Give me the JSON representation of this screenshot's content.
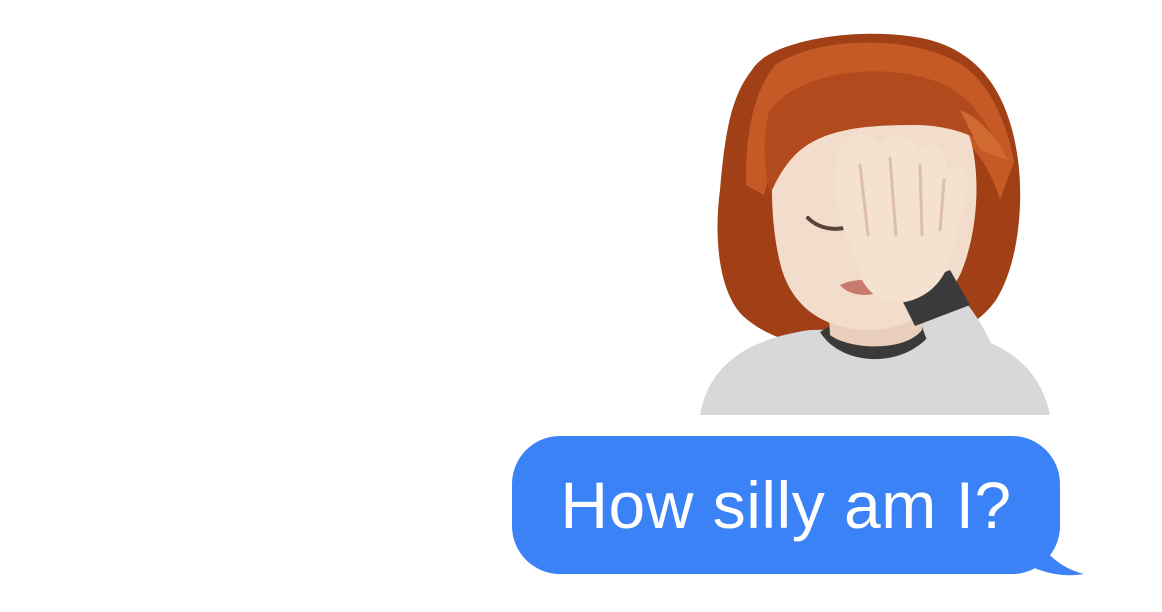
{
  "conversation": {
    "sticker": {
      "icon": "facepalm-memoji-icon",
      "colors": {
        "hair": "#b24a1d",
        "skin": "#f2dccb",
        "shirt": "#d8d8d8",
        "cuff": "#3a3a3a"
      }
    },
    "message": {
      "text": "How silly am I?",
      "bubble_color": "#3b82f6",
      "text_color": "#ffffff",
      "direction": "outgoing"
    }
  }
}
